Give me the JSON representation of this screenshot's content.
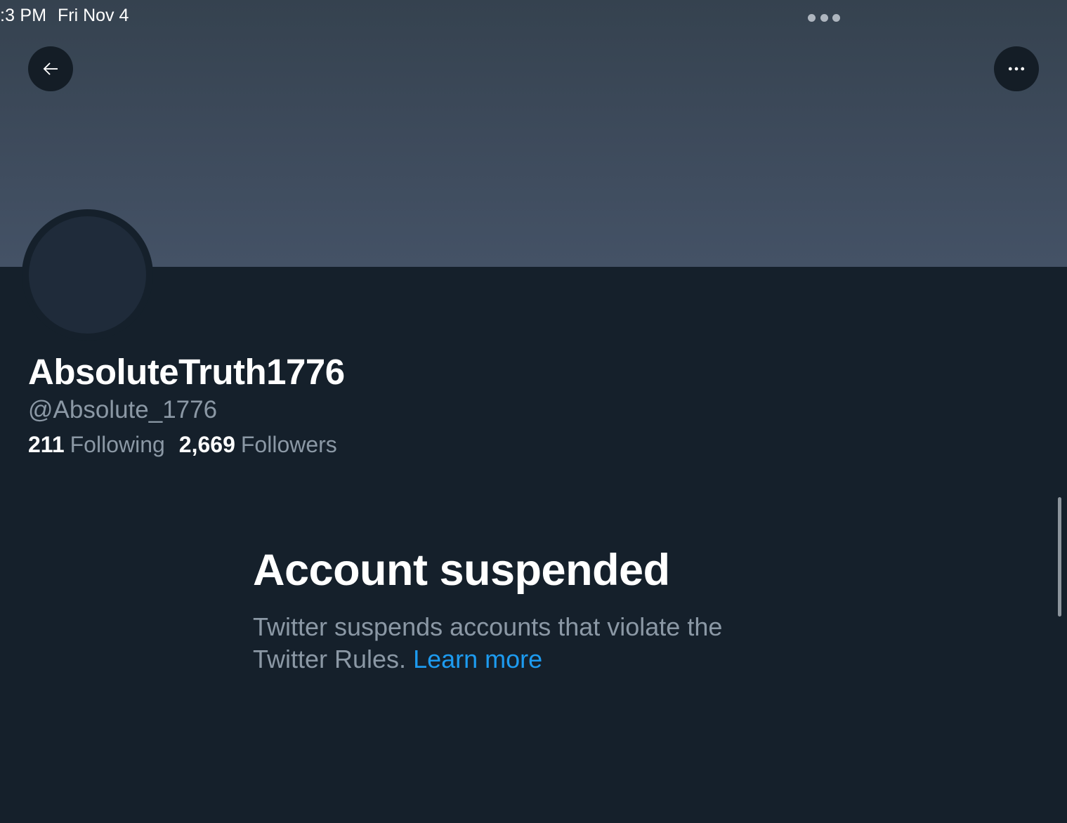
{
  "status_bar": {
    "time": ":3 PM",
    "date": "Fri Nov 4"
  },
  "header": {
    "back_icon": "arrow-left-icon",
    "more_icon": "ellipsis-horizontal-icon"
  },
  "profile": {
    "display_name": "AbsoluteTruth1776",
    "handle": "@Absolute_1776",
    "following_count": "211",
    "following_label": "Following",
    "followers_count": "2,669",
    "followers_label": "Followers"
  },
  "suspension": {
    "title": "Account suspended",
    "message_line1": "Twitter suspends accounts that violate the",
    "message_line2": "Twitter Rules.",
    "learn_more": "Learn more"
  },
  "colors": {
    "background": "#15202b",
    "accent": "#1d9bf0",
    "secondary_text": "#8b98a5"
  }
}
